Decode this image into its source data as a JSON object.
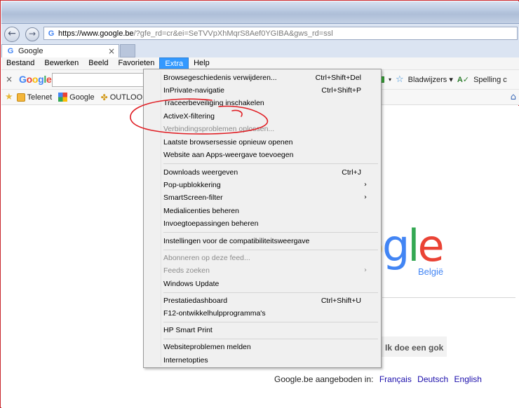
{
  "browser": {
    "address": {
      "host": "https://www.google.be",
      "path": "/?gfe_rd=cr&ei=SeTVVpXhMqrS8Aef0YGIBA&gws_rd=ssl"
    },
    "tab": {
      "title": "Google",
      "close": "×"
    },
    "menubar": [
      "Bestand",
      "Bewerken",
      "Beeld",
      "Favorieten",
      "Extra",
      "Help"
    ],
    "google_toolbar": {
      "close": "×",
      "logo": "Google",
      "bookmarks_label": "Bladwijzers ▾",
      "spelling_label": "Spelling c"
    },
    "favorites": [
      {
        "label": "Telenet"
      },
      {
        "label": "Google"
      },
      {
        "label": "OUTLOOK"
      }
    ]
  },
  "page": {
    "logo_partial": "ogle",
    "country": "België",
    "lucky_button": "Ik doe een gok",
    "offered_in": "Google.be aangeboden in:",
    "languages": [
      "Français",
      "Deutsch",
      "English"
    ]
  },
  "menu": {
    "items": [
      {
        "label": "Browsegeschiedenis verwijderen...",
        "shortcut": "Ctrl+Shift+Del"
      },
      {
        "label": "InPrivate-navigatie",
        "shortcut": "Ctrl+Shift+P"
      },
      {
        "label": "Traceerbeveiliging inschakelen",
        "shortcut": ""
      },
      {
        "label": "ActiveX-filtering",
        "shortcut": ""
      },
      {
        "label": "Verbindingsproblemen oplossen...",
        "shortcut": ""
      },
      {
        "label": "Laatste browsersessie opnieuw openen",
        "shortcut": ""
      },
      {
        "label": "Website aan Apps-weergave toevoegen",
        "shortcut": ""
      },
      {
        "label": "Downloads weergeven",
        "shortcut": "Ctrl+J"
      },
      {
        "label": "Pop-upblokkering",
        "shortcut": ""
      },
      {
        "label": "SmartScreen-filter",
        "shortcut": ""
      },
      {
        "label": "Medialicenties beheren",
        "shortcut": ""
      },
      {
        "label": "Invoegtoepassingen beheren",
        "shortcut": ""
      },
      {
        "label": "Instellingen voor de compatibiliteitsweergave",
        "shortcut": ""
      },
      {
        "label": "Abonneren op deze feed...",
        "shortcut": ""
      },
      {
        "label": "Feeds zoeken",
        "shortcut": ""
      },
      {
        "label": "Windows Update",
        "shortcut": ""
      },
      {
        "label": "Prestatiedashboard",
        "shortcut": "Ctrl+Shift+U"
      },
      {
        "label": "F12-ontwikkelhulpprogramma's",
        "shortcut": ""
      },
      {
        "label": "HP Smart Print",
        "shortcut": ""
      },
      {
        "label": "Websiteproblemen melden",
        "shortcut": ""
      },
      {
        "label": "Internetopties",
        "shortcut": ""
      }
    ]
  }
}
